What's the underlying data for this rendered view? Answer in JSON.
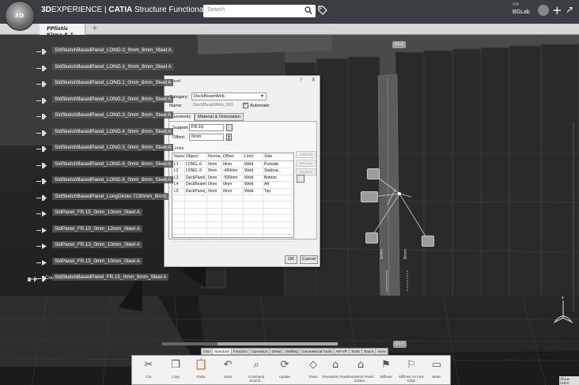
{
  "app": {
    "brand_3d": "3D",
    "brand_experience": "EXPERIENCE",
    "brand_sep": " | ",
    "brand_app": "CATIA",
    "brand_module": " Structure Functional Design",
    "compass_label": "3D"
  },
  "search": {
    "placeholder": "Search"
  },
  "user": {
    "role": "V.R",
    "name": "BGLab"
  },
  "tabs": [
    {
      "label": "PPlistic Kirna A.1"
    }
  ],
  "tree": {
    "items": [
      {
        "label": "SldSketchBasedPanel_LONG-2_0mm_8mm_Steel A"
      },
      {
        "label": "SldSketchBasedPanel_LONG-1_0mm_8mm_Steel A"
      },
      {
        "label": "SldSketchBasedPanel_LONG.1_0mm_8mm_Steel A"
      },
      {
        "label": "SldSketchBasedPanel_LONG.2_0mm_8mm_Steel A"
      },
      {
        "label": "SldSketchBasedPanel_LONG.3_0mm_8mm_Steel A"
      },
      {
        "label": "SldSketchBasedPanel_LONG.4_0mm_8mm_Steel A"
      },
      {
        "label": "SldSketchBasedPanel_LONG.5_0mm_8mm_Steel A"
      },
      {
        "label": "SldSketchBasedPanel_LONG.6_0mm_8mm_Steel A"
      },
      {
        "label": "SldSketchBasedPanel_LONG.8_0mm_8mm_Steel A"
      },
      {
        "label": "SldSketchBasedPanel_LongGirder.7230mm_8mm"
      },
      {
        "label": "SldPanel_FR.15_0mm_10mm_Steel A"
      },
      {
        "label": "SldPanel_FR.10_0mm_12mm_Steel A"
      },
      {
        "label": "SldPanel_FR.13_0mm_10mm_Steel A"
      },
      {
        "label": "SldPanel_FR.15_0mm_10mm_Steel A"
      },
      {
        "label": "SldSketchBasedPanel_FR.15_0mm_8mm_Steel A"
      }
    ],
    "root": {
      "label": "Construction Set"
    }
  },
  "dialog": {
    "title": "Panel",
    "help": "?",
    "close": "X",
    "category_label": "Category:",
    "category_value": "DeckBeamWeb",
    "name_label": "Name:",
    "name_value": "DeckBeamWeb_001",
    "auto_label": "Automatic",
    "auto_mark": "✓",
    "tab_geometry": "Geometry",
    "tab_material": "Material & Orientation",
    "support_label": "Support:",
    "support_value": "FR.16",
    "offset_label": "Offset:",
    "offset_value": "0mm",
    "limits_label": "Limits",
    "limits_headers": [
      "Name",
      "Object",
      "Norma...",
      "Offset",
      "Limit",
      "Side"
    ],
    "limits_rows": [
      [
        "L1",
        "LONG.-6",
        "0mm",
        "0mm",
        "Weld",
        "Portside"
      ],
      [
        "L2",
        "LONG.-5",
        "0mm",
        "-450mm",
        "Weld",
        "Starboa..."
      ],
      [
        "L3",
        "DeckPanel_Fa...",
        "0mm",
        "-500mm",
        "Weld",
        "Bottom"
      ],
      [
        "L4",
        "DeckBeamWe...",
        "0mm",
        "0mm",
        "Weld",
        "Aft"
      ],
      [
        "L5",
        "DeckPanel_Di...",
        "0mm",
        "0mm",
        "Weld",
        "Top"
      ]
    ],
    "side_buttons": [
      "Add/Edit",
      "Remove",
      "Replace"
    ],
    "ok": "OK",
    "cancel": "Cancel"
  },
  "viewport": {
    "chips": [
      {
        "label": "DEck"
      },
      {
        "label": "DEck"
      }
    ],
    "vert_label_1": "1mm",
    "vert_label_2": "0mm"
  },
  "section_tabs": [
    "Grid",
    "Standard",
    "Function",
    "Operation",
    "Detail",
    "Drafting",
    "Geometrical Tools",
    "AR-VR",
    "Tools",
    "Touch",
    "View"
  ],
  "section_tabs_active": "Standard",
  "actions": [
    {
      "label": "Cut",
      "icon": "cut-icon"
    },
    {
      "label": "Copy",
      "icon": "copy-icon"
    },
    {
      "label": "Paste",
      "icon": "paste-icon"
    },
    {
      "label": "Undo",
      "icon": "undo-icon"
    },
    {
      "label": "Command Search...",
      "icon": "command-search-icon"
    },
    {
      "label": "Update",
      "icon": "update-icon"
    },
    {
      "label": "Panel",
      "icon": "panel-icon"
    },
    {
      "label": "Parametric Panel",
      "icon": "parametric-panel-icon"
    },
    {
      "label": "Parametric Panel Instant...",
      "icon": "parametric-panel-instant-icon"
    },
    {
      "label": "Stiffener",
      "icon": "stiffener-icon"
    },
    {
      "label": "Stiffener on Free Edge",
      "icon": "stiffener-free-edge-icon"
    },
    {
      "label": "Beam",
      "icon": "beam-icon"
    }
  ],
  "corner_hint": "Show table"
}
